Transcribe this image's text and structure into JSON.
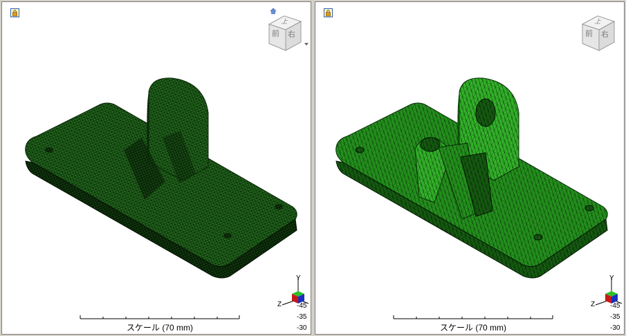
{
  "views": [
    {
      "id": "left",
      "scale_label": "スケール (70 mm)",
      "cube": {
        "top": "上",
        "front": "前",
        "right": "右"
      },
      "triad": {
        "y": "Y",
        "z": "Z"
      },
      "tick_labels": [
        "-45",
        "-35",
        "-30"
      ],
      "mesh_colors": {
        "fill": "#0e3b0b",
        "edge": "#3fa236"
      }
    },
    {
      "id": "right",
      "scale_label": "スケール (70 mm)",
      "cube": {
        "top": "上",
        "front": "前",
        "right": "右"
      },
      "triad": {
        "y": "Y",
        "z": "Z"
      },
      "tick_labels": [
        "-45",
        "-35",
        "-30"
      ],
      "mesh_colors": {
        "fill": "#1f7d1a",
        "edge": "#0b2a08"
      }
    }
  ],
  "icons": {
    "lock": "lock-icon",
    "home": "home-icon",
    "cube_menu": "chevron-down-icon"
  }
}
